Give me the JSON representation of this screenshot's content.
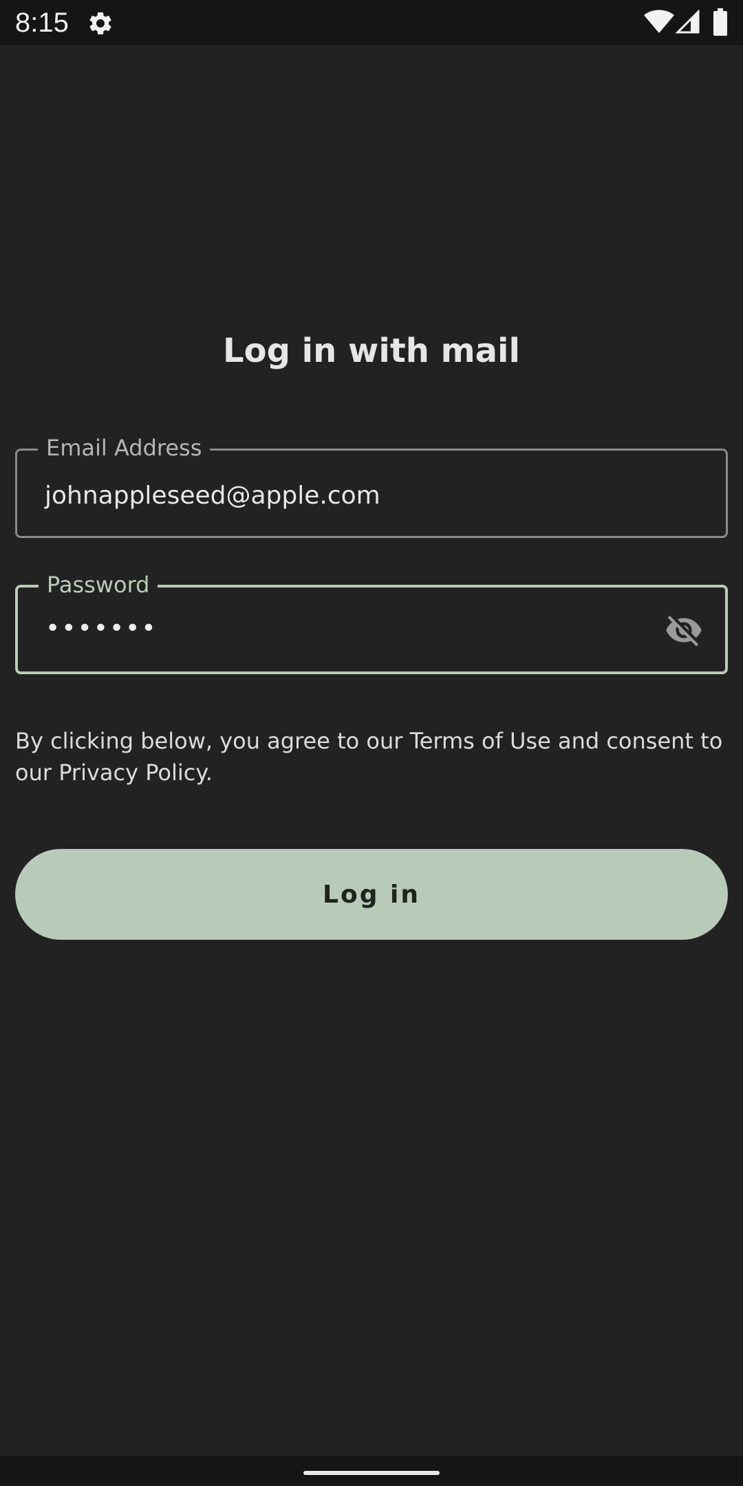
{
  "status_bar": {
    "time": "8:15",
    "icons": [
      "gear-icon",
      "wifi-icon",
      "signal-icon",
      "battery-icon"
    ]
  },
  "login": {
    "title": "Log in with mail",
    "email": {
      "label": "Email Address",
      "value": "johnappleseed@apple.com"
    },
    "password": {
      "label": "Password",
      "masked_value": "•••••••",
      "toggle_icon": "visibility-off-icon"
    },
    "consent_text": "By clicking below, you agree to our Terms of Use and consent to our Privacy Policy.",
    "button_label": "Log in"
  },
  "colors": {
    "background": "#222222",
    "accent": "#b8cab8",
    "focused_border": "#bccbb8"
  }
}
